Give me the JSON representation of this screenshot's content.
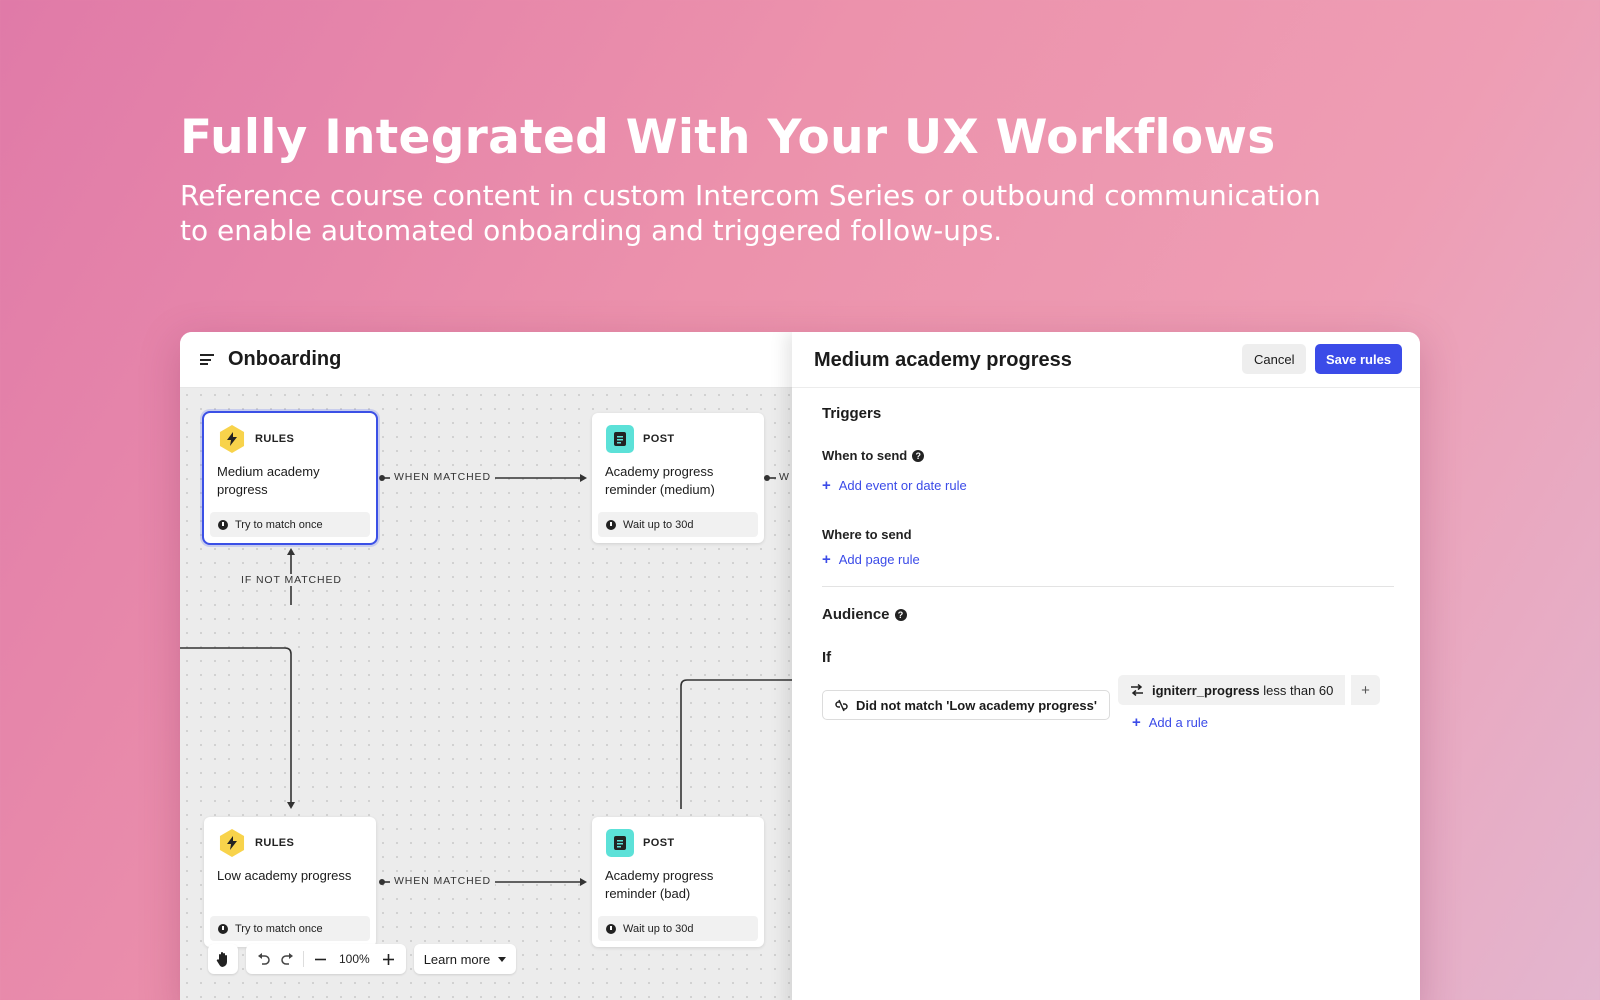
{
  "hero": {
    "title": "Fully Integrated With Your UX Workflows",
    "subtitle_line1": "Reference course content in custom Intercom Series or outbound communication",
    "subtitle_line2": "to enable automated onboarding and triggered follow-ups."
  },
  "app": {
    "title": "Onboarding",
    "menu_icon": "hamburger-menu-icon"
  },
  "canvas": {
    "nodes": [
      {
        "kind": "RULES",
        "title": "Medium academy progress",
        "footer": "Try to match once",
        "icon": "lightning-icon",
        "selected": true
      },
      {
        "kind": "POST",
        "title": "Academy progress reminder (medium)",
        "footer": "Wait up to 30d",
        "icon": "document-icon"
      },
      {
        "kind": "RULES",
        "title": "Low academy progress",
        "footer": "Try to match once",
        "icon": "lightning-icon"
      },
      {
        "kind": "POST",
        "title": "Academy progress reminder (bad)",
        "footer": "Wait up to 30d",
        "icon": "document-icon"
      }
    ],
    "edge_labels": {
      "when_matched": "WHEN MATCHED",
      "if_not_matched": "IF NOT MATCHED",
      "cut_off": "W"
    },
    "toolbar": {
      "zoom": "100%",
      "learn_more": "Learn more"
    }
  },
  "panel": {
    "title": "Medium academy progress",
    "cancel_label": "Cancel",
    "save_label": "Save rules",
    "triggers_title": "Triggers",
    "when_to_send_label": "When to send",
    "add_event_rule": "Add event or date rule",
    "where_to_send_label": "Where to send",
    "add_page_rule": "Add page rule",
    "audience_title": "Audience",
    "if_label": "If",
    "condition_not_match": "Did not match 'Low academy progress'",
    "rule_attribute": "igniterr_progress",
    "rule_operator_value": "less than 60",
    "add_rule": "Add a rule",
    "help_mark": "?",
    "plus": "+"
  },
  "colors": {
    "accent": "#3b4be8",
    "rules_badge": "#f8d34b",
    "post_badge": "#5ce1d8"
  }
}
